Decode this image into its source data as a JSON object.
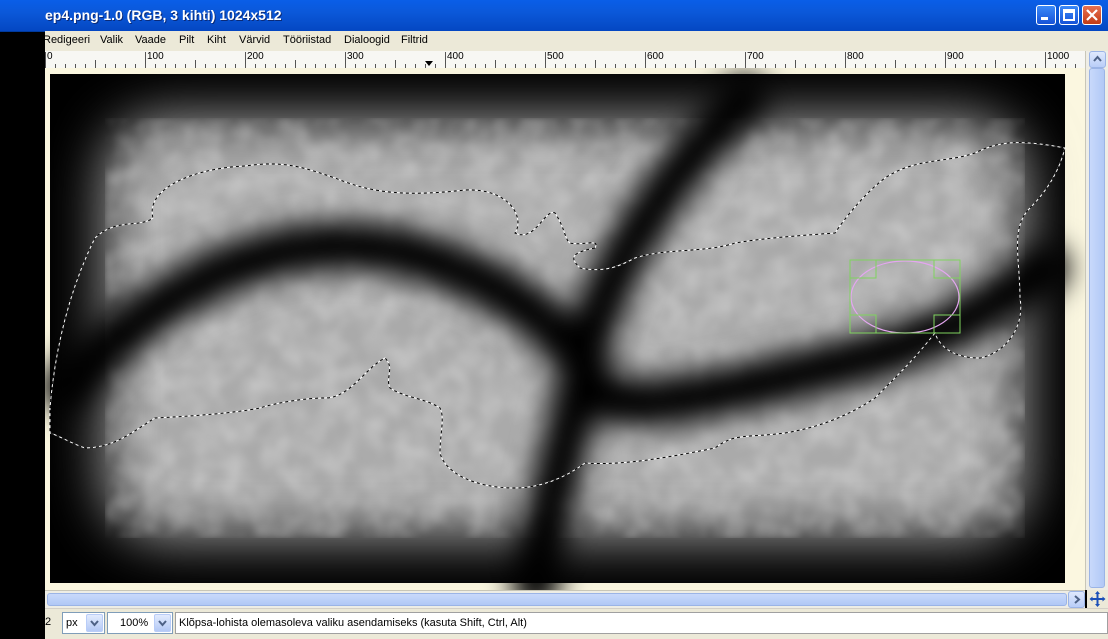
{
  "window": {
    "title": "ep4.png-1.0 (RGB, 3 kihti) 1024x512"
  },
  "menu": [
    "Redigeeri",
    "Valik",
    "Vaade",
    "Pilt",
    "Kiht",
    "Värvid",
    "Tööriistad",
    "Dialoogid",
    "Filtrid"
  ],
  "ruler": {
    "labels": [
      "0",
      "100",
      "200",
      "300",
      "400",
      "500",
      "600",
      "700",
      "800",
      "900",
      "1000"
    ]
  },
  "status": {
    "coord_fragment": "2",
    "unit": "px",
    "zoom": "100%",
    "message": "Klõpsa-lohista olemasoleva valiku asendamiseks (kasuta Shift, Ctrl, Alt)"
  },
  "colors": {
    "titlebar": "#0b58d9",
    "chrome": "#ece9d8",
    "selection_handles": "#7fd35e",
    "ellipse_preview": "#e4a6f0"
  }
}
